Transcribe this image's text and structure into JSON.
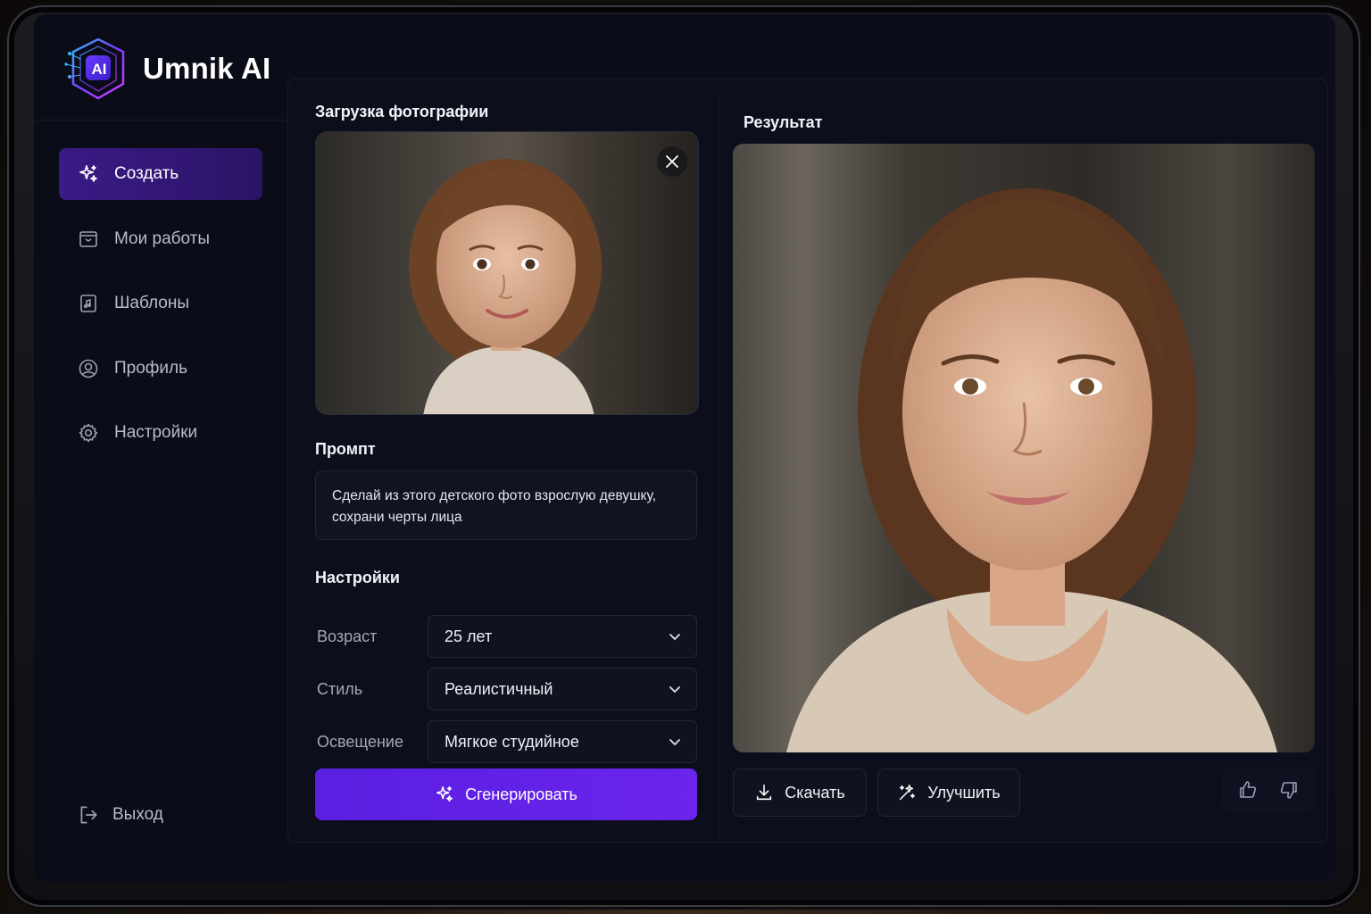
{
  "app": {
    "name": "Umnik AI",
    "logo_text": "AI",
    "accent": "#6a24ec"
  },
  "sidebar": {
    "items": [
      {
        "label": "Создать",
        "icon": "sparkles-icon",
        "active": true
      },
      {
        "label": "Мои работы",
        "icon": "folder-icon",
        "active": false
      },
      {
        "label": "Шаблоны",
        "icon": "template-icon",
        "active": false
      },
      {
        "label": "Профиль",
        "icon": "user-circle-icon",
        "active": false
      },
      {
        "label": "Настройки",
        "icon": "gear-icon",
        "active": false
      }
    ],
    "logout_label": "Выход"
  },
  "upload": {
    "title": "Загрузка фотографии",
    "image_description_icon": "child-portrait-photo"
  },
  "prompt": {
    "title": "Промпт",
    "value": "Сделай из этого детского фото взрослую девушку, сохрани черты лица"
  },
  "settings": {
    "title": "Настройки",
    "age": {
      "label": "Возраст",
      "value": "25 лет"
    },
    "style": {
      "label": "Стиль",
      "value": "Реалистичный"
    },
    "lighting": {
      "label": "Освещение",
      "value": "Мягкое студийное"
    }
  },
  "generate_label": "Сгенерировать",
  "result": {
    "title": "Результат",
    "download_label": "Скачать",
    "improve_label": "Улучшить"
  }
}
